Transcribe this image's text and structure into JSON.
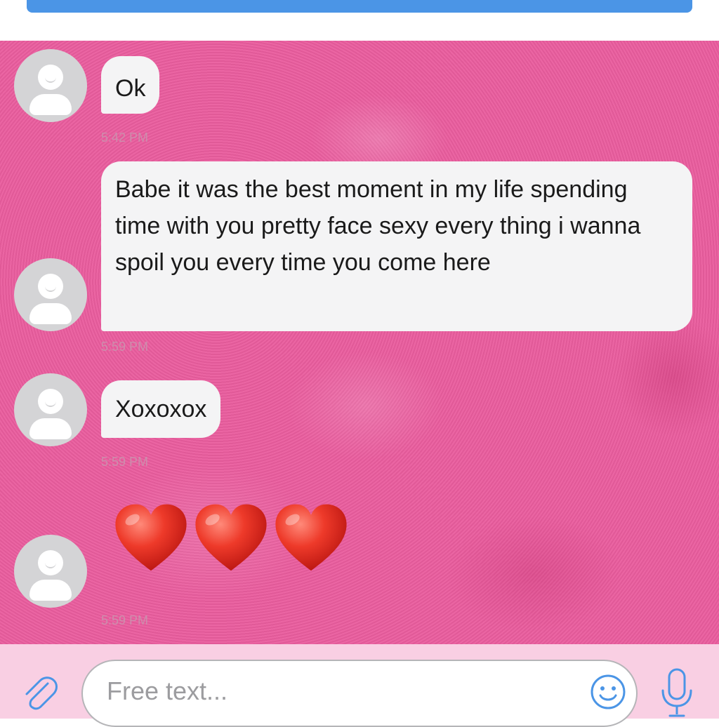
{
  "colors": {
    "chat_background": "#ea5d9e",
    "bubble": "#f4f4f5",
    "top_bar": "#4b95e6",
    "input_bar": "#f9cfe3",
    "icon_blue": "#4b95e6",
    "heart_red": "#e0251c"
  },
  "messages": [
    {
      "text": "Ok",
      "time": "5:42 PM"
    },
    {
      "text": "Babe it was the best moment in my life spending time with you pretty face sexy every thing i wanna spoil you every time you come here",
      "time": "5:59 PM"
    },
    {
      "text": "Xoxoxox",
      "time": "5:59 PM"
    },
    {
      "emoji": [
        "red-heart",
        "red-heart",
        "red-heart"
      ],
      "time": "5:59 PM"
    }
  ],
  "composer": {
    "placeholder": "Free text...",
    "attach_icon": "paperclip-icon",
    "emoji_icon": "smiley-icon",
    "mic_icon": "microphone-icon"
  }
}
